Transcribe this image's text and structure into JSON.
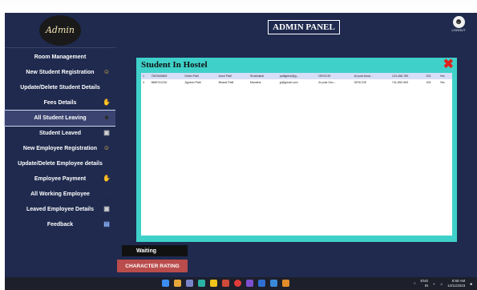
{
  "header": {
    "title": "ADMIN PANEL",
    "logout_label": "LOGOUT"
  },
  "logo": {
    "text": "Admin"
  },
  "sidebar": {
    "items": [
      {
        "label": "Room Management",
        "icon": "circle-icon"
      },
      {
        "label": "New Student Registration",
        "icon": "user-add-icon"
      },
      {
        "label": "Update/Delete Student Details",
        "icon": ""
      },
      {
        "label": "Fees  Details",
        "icon": "money-hand-icon"
      },
      {
        "label": "All Student Leaving",
        "icon": "square-icon"
      },
      {
        "label": "Student Leaved",
        "icon": "exit-icon"
      },
      {
        "label": "New Employee Registration",
        "icon": "user-add-icon"
      },
      {
        "label": "Update/Delete Employee details",
        "icon": ""
      },
      {
        "label": "Employee Payment",
        "icon": "money-hand-icon"
      },
      {
        "label": "All Working Employee",
        "icon": "circle-icon"
      },
      {
        "label": "Leaved Employee Details",
        "icon": "exit-icon"
      },
      {
        "label": "Feedback",
        "icon": "document-icon"
      }
    ]
  },
  "panel": {
    "title": "Student In Hostel",
    "rows": [
      [
        "1",
        "7387645869",
        "Girish Patil",
        "Amol Patil",
        "Shobhabai",
        "patilgirish@g...",
        "GESCOE",
        "At post Amal...",
        "123-456-789",
        "103",
        "Yes"
      ],
      [
        "4",
        "9685741230",
        "Jignesh Patil",
        "Bharat Patil",
        "Manisha",
        "jp@gmail.com",
        "At post Gov...",
        "GESCOE",
        "741-852-963",
        "105",
        "Yes"
      ]
    ]
  },
  "buttons": {
    "waiting": "Waiting",
    "character_rating": "CHARACTER RATING"
  },
  "taskbar": {
    "lang_top": "ENG",
    "lang_bottom": "IN",
    "time": "8:58 AM",
    "date": "12/11/2023"
  }
}
